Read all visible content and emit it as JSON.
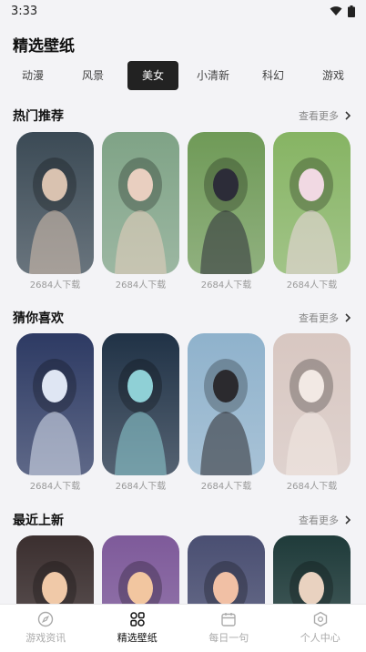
{
  "status_bar": {
    "time": "3:33"
  },
  "page": {
    "title": "精选壁纸"
  },
  "tabs": [
    {
      "label": "动漫"
    },
    {
      "label": "风景"
    },
    {
      "label": "美女"
    },
    {
      "label": "小清新"
    },
    {
      "label": "科幻"
    },
    {
      "label": "游戏"
    }
  ],
  "active_tab": "美女",
  "sections": [
    {
      "title": "热门推荐",
      "more": "查看更多",
      "items": [
        {
          "caption": "2684人下载",
          "palette": [
            "#3b4a55",
            "#d9c2b0"
          ]
        },
        {
          "caption": "2684人下载",
          "palette": [
            "#7fa386",
            "#e9cfc0"
          ]
        },
        {
          "caption": "2684人下载",
          "palette": [
            "#6f9a57",
            "#2c2c38"
          ]
        },
        {
          "caption": "2684人下载",
          "palette": [
            "#86b463",
            "#f1d9e3"
          ]
        }
      ]
    },
    {
      "title": "猜你喜欢",
      "more": "查看更多",
      "items": [
        {
          "caption": "2684人下载",
          "palette": [
            "#2d3a63",
            "#dfe6f3"
          ]
        },
        {
          "caption": "2684人下载",
          "palette": [
            "#203246",
            "#8fd0d6"
          ]
        },
        {
          "caption": "2684人下载",
          "palette": [
            "#8fb2cc",
            "#2b2a2e"
          ]
        },
        {
          "caption": "2684人下载",
          "palette": [
            "#d8c7c1",
            "#f2e9e4"
          ]
        }
      ]
    },
    {
      "title": "最近上新",
      "more": "查看更多",
      "items": [
        {
          "palette": [
            "#3b2f2f",
            "#f0c9a8"
          ]
        },
        {
          "palette": [
            "#7e5a9a",
            "#f2c6a0"
          ]
        },
        {
          "palette": [
            "#4a4f72",
            "#f1c0a5"
          ]
        },
        {
          "palette": [
            "#1f3b3a",
            "#e9d2c0"
          ]
        }
      ]
    }
  ],
  "bottom_nav": [
    {
      "label": "游戏资讯",
      "icon": "compass-icon"
    },
    {
      "label": "精选壁纸",
      "icon": "grid-icon"
    },
    {
      "label": "每日一句",
      "icon": "calendar-icon"
    },
    {
      "label": "个人中心",
      "icon": "user-icon"
    }
  ],
  "active_nav": "精选壁纸"
}
